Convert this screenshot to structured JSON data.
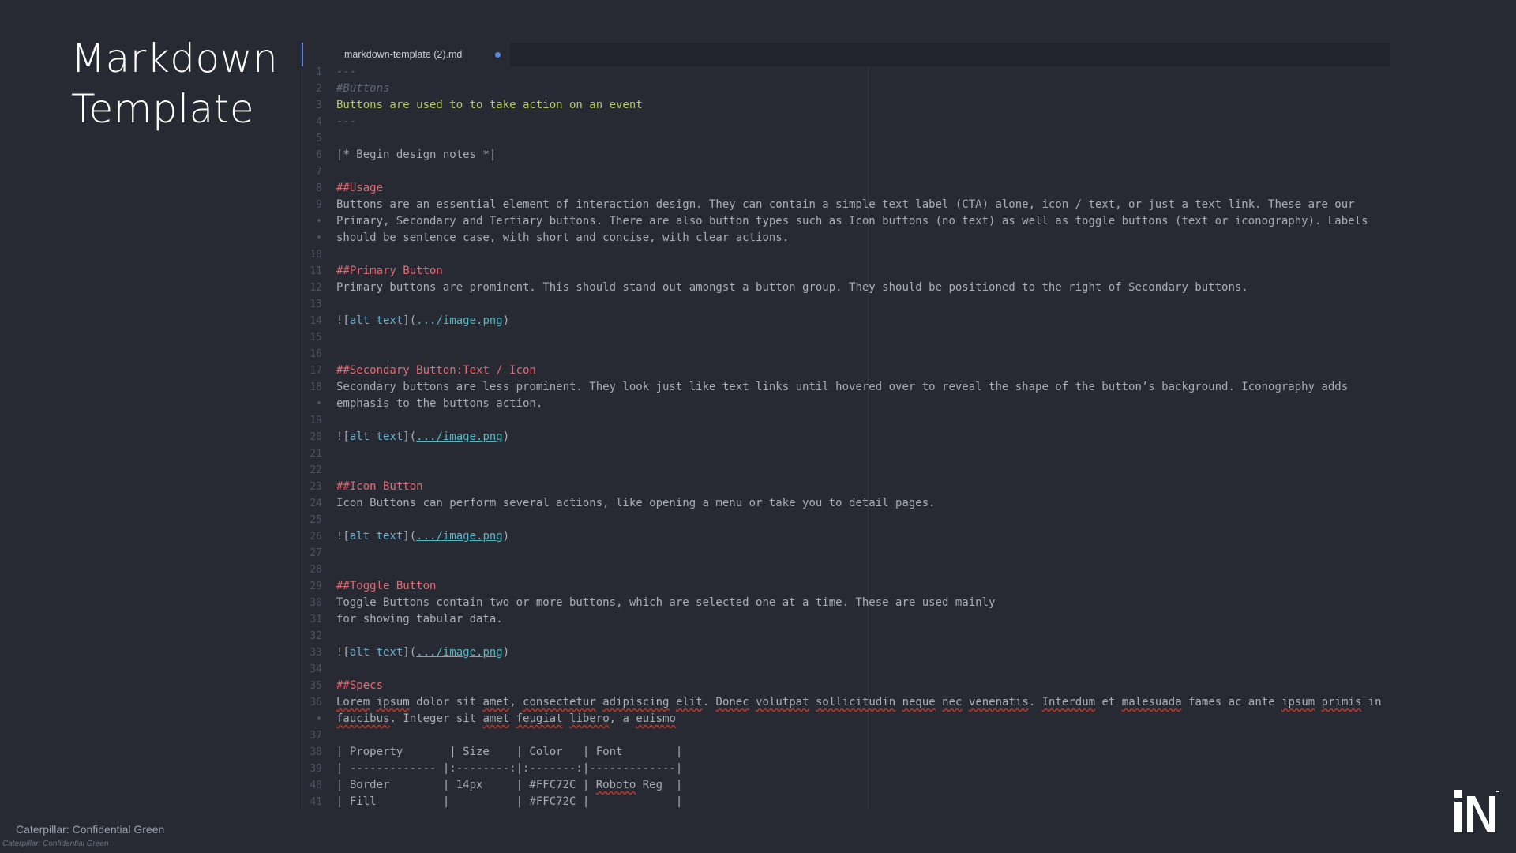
{
  "page_title_line1": "Markdown",
  "page_title_line2": "Template",
  "tab": {
    "filename": "markdown-template (2).md",
    "unsaved_indicator_color": "#5a86e0"
  },
  "footer": {
    "confidential_label": "Caterpillar: Confidential Green",
    "confidential_small": "Caterpillar: Confidential Green"
  },
  "logo": {
    "icon": "in-logo"
  },
  "lines": [
    {
      "ln": "1",
      "t": [
        {
          "s": "---",
          "c": "comment"
        }
      ]
    },
    {
      "ln": "2",
      "t": [
        {
          "s": "#Buttons",
          "c": "comment"
        }
      ]
    },
    {
      "ln": "3",
      "t": [
        {
          "s": "Buttons are used to to take action on an event",
          "c": "green"
        }
      ]
    },
    {
      "ln": "4",
      "t": [
        {
          "s": "---",
          "c": "comment"
        }
      ]
    },
    {
      "ln": "5",
      "t": []
    },
    {
      "ln": "6",
      "t": [
        {
          "s": "|* Begin design notes *|",
          "c": "normal"
        }
      ]
    },
    {
      "ln": "7",
      "t": []
    },
    {
      "ln": "8",
      "t": [
        {
          "s": "##Usage",
          "c": "head"
        }
      ]
    },
    {
      "ln": "9",
      "t": [
        {
          "s": "Buttons are an essential element of interaction design. They can contain a simple text label (CTA) alone, icon / text, or just a text link. These are our",
          "c": "normal"
        }
      ]
    },
    {
      "ln": "•",
      "t": [
        {
          "s": "Primary, Secondary and Tertiary buttons. There are also button types such as Icon buttons (no text) as well as toggle buttons (text or iconography). Labels",
          "c": "normal"
        }
      ]
    },
    {
      "ln": "•",
      "t": [
        {
          "s": "should be sentence case, with short and concise, with clear actions.",
          "c": "normal"
        }
      ]
    },
    {
      "ln": "10",
      "t": []
    },
    {
      "ln": "11",
      "t": [
        {
          "s": "##Primary Button",
          "c": "head"
        }
      ]
    },
    {
      "ln": "12",
      "t": [
        {
          "s": "Primary buttons are prominent. This should stand out amongst a button group. They should be positioned to the right of Secondary buttons.",
          "c": "normal"
        }
      ]
    },
    {
      "ln": "13",
      "t": []
    },
    {
      "ln": "14",
      "t": [
        {
          "s": "![",
          "c": "normal"
        },
        {
          "s": "alt text",
          "c": "link"
        },
        {
          "s": "](",
          "c": "normal"
        },
        {
          "s": ".../image.png",
          "c": "url"
        },
        {
          "s": ")",
          "c": "normal"
        }
      ]
    },
    {
      "ln": "15",
      "t": []
    },
    {
      "ln": "16",
      "t": []
    },
    {
      "ln": "17",
      "t": [
        {
          "s": "##Secondary Button:Text / Icon",
          "c": "head"
        }
      ]
    },
    {
      "ln": "18",
      "t": [
        {
          "s": "Secondary buttons are less prominent. They look just like text links until hovered over to reveal the shape of the button’s background. Iconography adds",
          "c": "normal"
        }
      ]
    },
    {
      "ln": "•",
      "t": [
        {
          "s": "emphasis to the buttons action.",
          "c": "normal"
        }
      ]
    },
    {
      "ln": "19",
      "t": []
    },
    {
      "ln": "20",
      "t": [
        {
          "s": "![",
          "c": "normal"
        },
        {
          "s": "alt text",
          "c": "link"
        },
        {
          "s": "](",
          "c": "normal"
        },
        {
          "s": ".../image.png",
          "c": "url"
        },
        {
          "s": ")",
          "c": "normal"
        }
      ]
    },
    {
      "ln": "21",
      "t": []
    },
    {
      "ln": "22",
      "t": []
    },
    {
      "ln": "23",
      "t": [
        {
          "s": "##Icon Button",
          "c": "head"
        }
      ]
    },
    {
      "ln": "24",
      "t": [
        {
          "s": "Icon Buttons can perform several actions, like opening a menu or take you to detail pages.",
          "c": "normal"
        }
      ]
    },
    {
      "ln": "25",
      "t": []
    },
    {
      "ln": "26",
      "t": [
        {
          "s": "![",
          "c": "normal"
        },
        {
          "s": "alt text",
          "c": "link"
        },
        {
          "s": "](",
          "c": "normal"
        },
        {
          "s": ".../image.png",
          "c": "url"
        },
        {
          "s": ")",
          "c": "normal"
        }
      ]
    },
    {
      "ln": "27",
      "t": []
    },
    {
      "ln": "28",
      "t": []
    },
    {
      "ln": "29",
      "t": [
        {
          "s": "##Toggle Button",
          "c": "head"
        }
      ]
    },
    {
      "ln": "30",
      "t": [
        {
          "s": "Toggle Buttons contain two or more buttons, which are selected one at a time. These are used mainly",
          "c": "normal"
        }
      ]
    },
    {
      "ln": "31",
      "t": [
        {
          "s": "for showing tabular data.",
          "c": "normal"
        }
      ]
    },
    {
      "ln": "32",
      "t": []
    },
    {
      "ln": "33",
      "t": [
        {
          "s": "![",
          "c": "normal"
        },
        {
          "s": "alt text",
          "c": "link"
        },
        {
          "s": "](",
          "c": "normal"
        },
        {
          "s": ".../image.png",
          "c": "url"
        },
        {
          "s": ")",
          "c": "normal"
        }
      ]
    },
    {
      "ln": "34",
      "t": []
    },
    {
      "ln": "35",
      "t": [
        {
          "s": "##Specs",
          "c": "head"
        }
      ]
    },
    {
      "ln": "36",
      "t": [
        {
          "s": "Lorem",
          "c": "spell"
        },
        {
          "s": " ",
          "c": "normal"
        },
        {
          "s": "ipsum",
          "c": "spell"
        },
        {
          "s": " dolor sit ",
          "c": "normal"
        },
        {
          "s": "amet",
          "c": "spell"
        },
        {
          "s": ", ",
          "c": "normal"
        },
        {
          "s": "consectetur",
          "c": "spell"
        },
        {
          "s": " ",
          "c": "normal"
        },
        {
          "s": "adipiscing",
          "c": "spell"
        },
        {
          "s": " ",
          "c": "normal"
        },
        {
          "s": "elit",
          "c": "spell"
        },
        {
          "s": ". ",
          "c": "normal"
        },
        {
          "s": "Donec",
          "c": "spell"
        },
        {
          "s": " ",
          "c": "normal"
        },
        {
          "s": "volutpat",
          "c": "spell"
        },
        {
          "s": " ",
          "c": "normal"
        },
        {
          "s": "sollicitudin",
          "c": "spell"
        },
        {
          "s": " ",
          "c": "normal"
        },
        {
          "s": "neque",
          "c": "spell"
        },
        {
          "s": " ",
          "c": "normal"
        },
        {
          "s": "nec",
          "c": "spell"
        },
        {
          "s": " ",
          "c": "normal"
        },
        {
          "s": "venenatis",
          "c": "spell"
        },
        {
          "s": ". ",
          "c": "normal"
        },
        {
          "s": "Interdum",
          "c": "spell"
        },
        {
          "s": " et ",
          "c": "normal"
        },
        {
          "s": "malesuada",
          "c": "spell"
        },
        {
          "s": " fames ac ante ",
          "c": "normal"
        },
        {
          "s": "ipsum",
          "c": "spell"
        },
        {
          "s": " ",
          "c": "normal"
        },
        {
          "s": "primis",
          "c": "spell"
        },
        {
          "s": " in",
          "c": "normal"
        }
      ]
    },
    {
      "ln": "•",
      "t": [
        {
          "s": "faucibus",
          "c": "spell"
        },
        {
          "s": ". Integer sit ",
          "c": "normal"
        },
        {
          "s": "amet",
          "c": "spell"
        },
        {
          "s": " ",
          "c": "normal"
        },
        {
          "s": "feugiat",
          "c": "spell"
        },
        {
          "s": " ",
          "c": "normal"
        },
        {
          "s": "libero",
          "c": "spell"
        },
        {
          "s": ", a ",
          "c": "normal"
        },
        {
          "s": "euismo",
          "c": "spell"
        }
      ]
    },
    {
      "ln": "37",
      "t": []
    },
    {
      "ln": "38",
      "t": [
        {
          "s": "| Property       | Size    | Color   | Font        |",
          "c": "normal"
        }
      ]
    },
    {
      "ln": "39",
      "t": [
        {
          "s": "| ------------- |:--------:|:-------:|-------------|",
          "c": "normal"
        }
      ]
    },
    {
      "ln": "40",
      "t": [
        {
          "s": "| Border        | 14px     | #FFC72C | ",
          "c": "normal"
        },
        {
          "s": "Roboto",
          "c": "spell"
        },
        {
          "s": " Reg  |",
          "c": "normal"
        }
      ]
    },
    {
      "ln": "41",
      "t": [
        {
          "s": "| Fill          |          | #FFC72C |             |",
          "c": "normal"
        }
      ]
    }
  ]
}
